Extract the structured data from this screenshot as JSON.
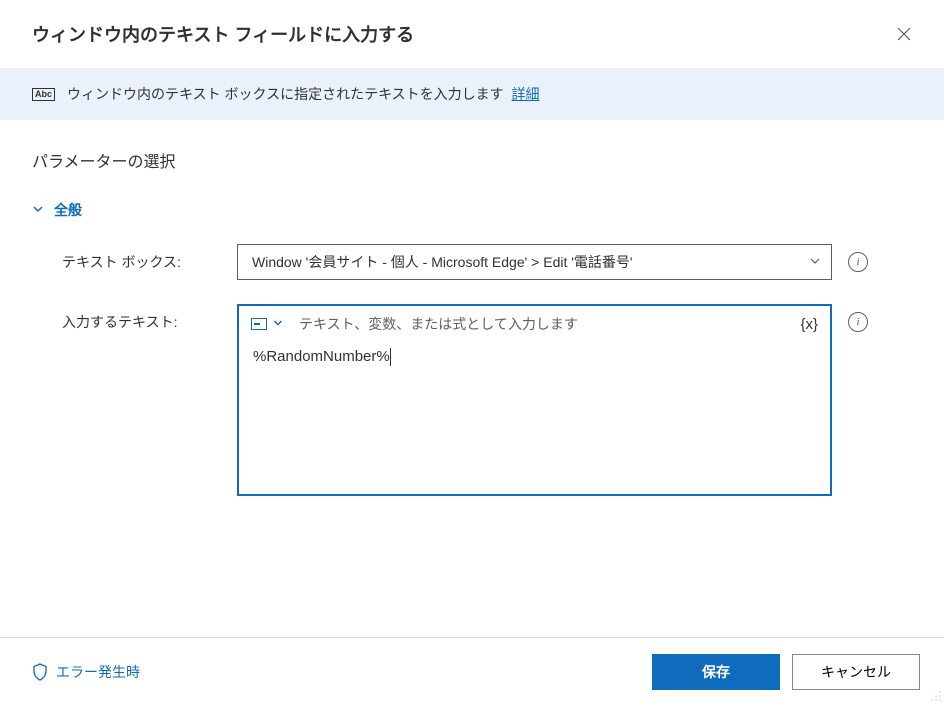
{
  "header": {
    "title": "ウィンドウ内のテキスト フィールドに入力する"
  },
  "banner": {
    "icon_label": "Abc",
    "text": "ウィンドウ内のテキスト ボックスに指定されたテキストを入力します",
    "link": "詳細"
  },
  "section": {
    "title": "パラメーターの選択"
  },
  "collapsible": {
    "label": "全般"
  },
  "params": {
    "textbox": {
      "label": "テキスト ボックス:",
      "value": "Window '会員サイト - 個人 - Microsoft Edge' > Edit '電話番号'"
    },
    "input_text": {
      "label": "入力するテキスト:",
      "placeholder": "テキスト、変数、または式として入力します",
      "value": "%RandomNumber%",
      "var_icon": "{x}"
    }
  },
  "footer": {
    "error_link": "エラー発生時",
    "save": "保存",
    "cancel": "キャンセル"
  }
}
